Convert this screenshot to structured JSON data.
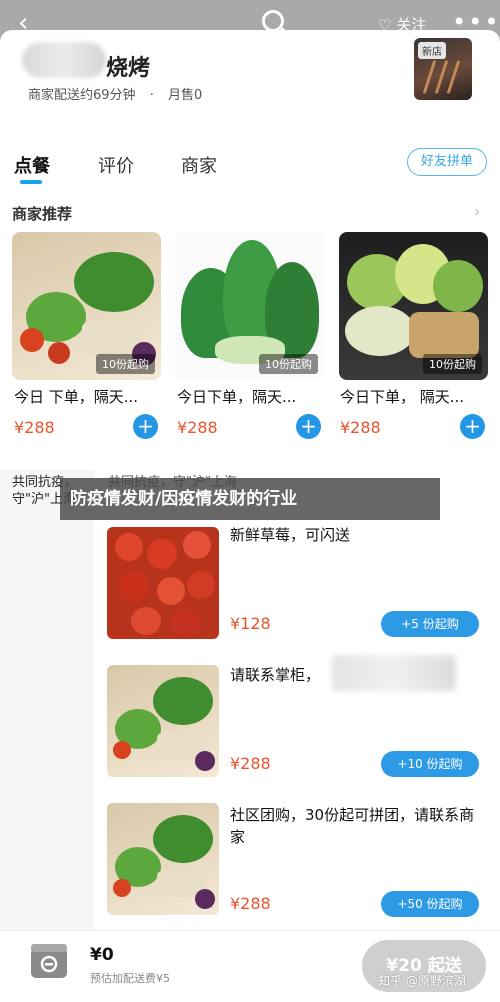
{
  "topbar": {
    "back_icon": "‹",
    "follow_label": "关注",
    "more_icon": "•••"
  },
  "shop": {
    "name_suffix": "烧烤",
    "delivery": "商家配送约69分钟",
    "monthly_sales": "月售0",
    "logo_tag": "新店"
  },
  "tabs": [
    {
      "label": "点餐",
      "active": true
    },
    {
      "label": "评价",
      "active": false
    },
    {
      "label": "商家",
      "active": false
    }
  ],
  "friend_button": "好友拼单",
  "recommend": {
    "title": "商家推荐",
    "items": [
      {
        "title": "今日 下单，隔天...",
        "price": "¥288",
        "badge": "10份起购"
      },
      {
        "title": "今日下单，隔天...",
        "price": "¥288",
        "badge": "10份起购"
      },
      {
        "title": "今日下单，  隔天...",
        "price": "¥288",
        "badge": "10份起购"
      }
    ]
  },
  "categories": {
    "left": "共同抗疫，守\"沪\"上海",
    "right": "共同抗疫，守\"沪\"上海"
  },
  "banner": "防疫情发财/因疫情发财的行业",
  "list": [
    {
      "title": "新鲜草莓，可闪送",
      "price": "¥128",
      "moq": "+5 份起购"
    },
    {
      "title": "请联系掌柜，",
      "price": "¥288",
      "moq": "+10 份起购"
    },
    {
      "title": "社区团购，30份起可拼团，请联系商家",
      "price": "¥288",
      "moq": "+50 份起购"
    }
  ],
  "cart": {
    "total": "¥0",
    "note": "预估加配送费¥5",
    "checkout": "¥20 起送"
  },
  "watermark": "知乎 @原野滨湖",
  "colors": {
    "accent": "#2396e6",
    "price": "#e8542e",
    "topbar": "#a9a9a9"
  }
}
